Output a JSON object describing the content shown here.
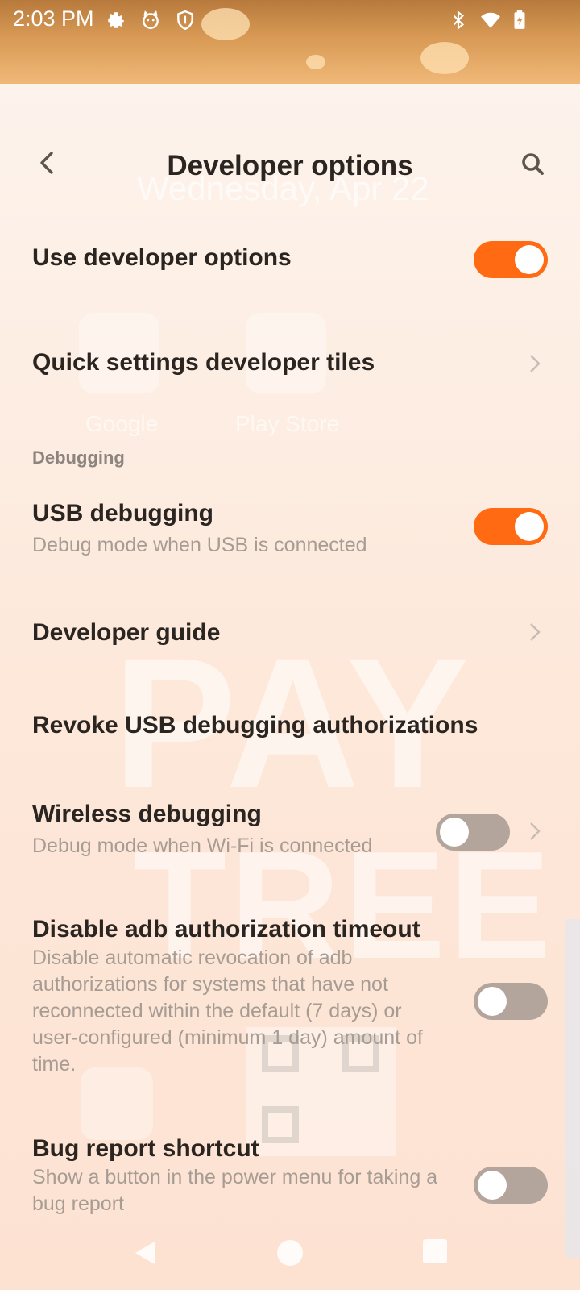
{
  "status_bar": {
    "time": "2:03 PM",
    "icons": [
      "gear-icon",
      "cat-face-icon",
      "shield-icon",
      "bluetooth-icon",
      "wifi-icon",
      "battery-icon"
    ]
  },
  "background": {
    "date": "Wednesday, Apr 22",
    "apps": [
      "Google",
      "Play Store"
    ],
    "watermark_line1": "PAY",
    "watermark_line2": "TREE"
  },
  "header": {
    "title": "Developer options",
    "back_icon": "back-arrow-icon",
    "search_icon": "search-icon"
  },
  "items": [
    {
      "title": "Use developer options",
      "type": "toggle",
      "state": "on"
    },
    {
      "title": "Quick settings developer tiles",
      "type": "link"
    },
    {
      "title": "USB debugging",
      "summary": "Debug mode when USB is connected",
      "type": "toggle",
      "state": "on"
    },
    {
      "title": "Developer guide",
      "type": "link"
    },
    {
      "title": "Revoke USB debugging authorizations",
      "type": "action"
    },
    {
      "title": "Wireless debugging",
      "summary": "Debug mode when Wi-Fi is connected",
      "type": "toggle-link",
      "state": "off"
    },
    {
      "title": "Disable adb authorization timeout",
      "summary": "Disable automatic revocation of adb authorizations for systems that have not reconnected within the default (7 days) or user-configured (minimum 1 day) amount of time.",
      "type": "toggle",
      "state": "off"
    },
    {
      "title": "Bug report shortcut",
      "summary": "Show a button in the power menu for taking a bug report",
      "type": "toggle",
      "state": "off"
    }
  ],
  "sections": {
    "debugging": "Debugging"
  },
  "colors": {
    "accent": "#ff6a12",
    "toggle_off": "#b3a49c",
    "title_text": "#2b2521",
    "summary_text": "#a79c94"
  }
}
